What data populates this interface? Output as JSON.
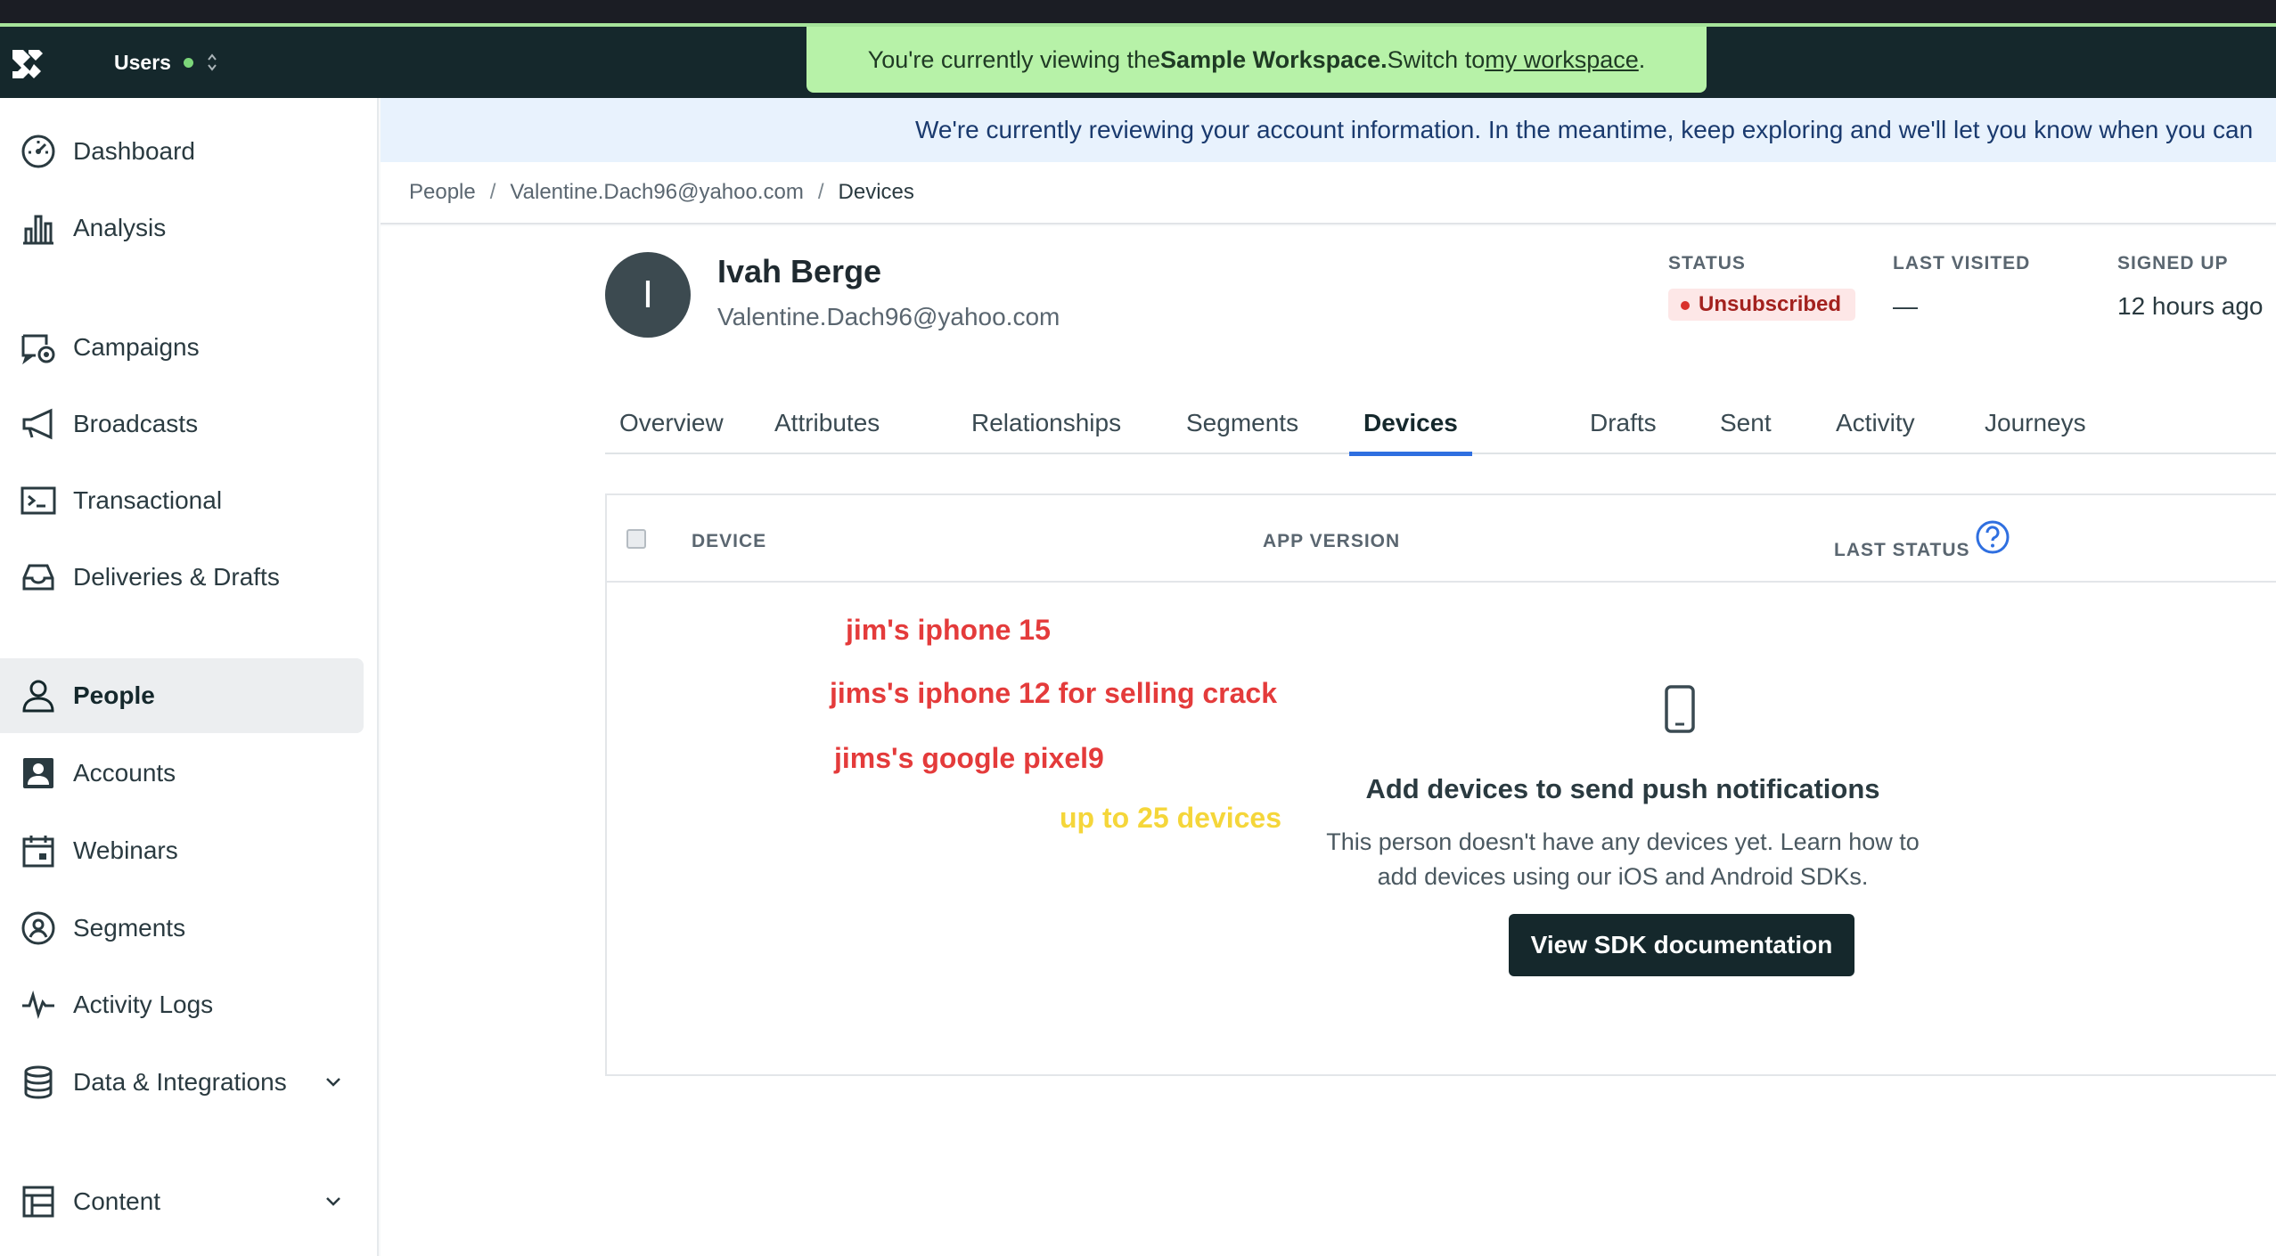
{
  "topbar": {
    "workspace_label": "Users",
    "banner": {
      "prefix": "You're currently viewing the ",
      "workspace_name": "Sample Workspace.",
      "middle": " Switch to ",
      "link": "my workspace",
      "suffix": "."
    }
  },
  "sidebar": {
    "items": [
      {
        "label": "Dashboard",
        "icon": "dashboard-icon"
      },
      {
        "label": "Analysis",
        "icon": "bar-chart-icon"
      },
      {
        "label": "Campaigns",
        "icon": "campaign-icon"
      },
      {
        "label": "Broadcasts",
        "icon": "megaphone-icon"
      },
      {
        "label": "Transactional",
        "icon": "terminal-icon"
      },
      {
        "label": "Deliveries & Drafts",
        "icon": "inbox-icon"
      },
      {
        "label": "People",
        "icon": "person-icon",
        "active": true
      },
      {
        "label": "Accounts",
        "icon": "account-card-icon"
      },
      {
        "label": "Webinars",
        "icon": "calendar-icon"
      },
      {
        "label": "Segments",
        "icon": "segment-icon"
      },
      {
        "label": "Activity Logs",
        "icon": "pulse-icon"
      },
      {
        "label": "Data & Integrations",
        "icon": "database-icon"
      },
      {
        "label": "Content",
        "icon": "layout-icon"
      }
    ]
  },
  "review_banner": "We're currently reviewing your account information. In the meantime, keep exploring and we'll let you know when you can",
  "breadcrumb": {
    "root": "People",
    "person": "Valentine.Dach96@yahoo.com",
    "current": "Devices"
  },
  "profile": {
    "initial": "I",
    "name": "Ivah Berge",
    "email": "Valentine.Dach96@yahoo.com",
    "status_label": "STATUS",
    "status_value": "Unsubscribed",
    "last_visited_label": "LAST VISITED",
    "last_visited_value": "—",
    "signed_up_label": "SIGNED UP",
    "signed_up_value": "12 hours ago"
  },
  "tabs": [
    "Overview",
    "Attributes",
    "Relationships",
    "Segments",
    "Devices",
    "Drafts",
    "Sent",
    "Activity",
    "Journeys"
  ],
  "active_tab": "Devices",
  "devices_table": {
    "columns": [
      "DEVICE",
      "APP VERSION",
      "LAST STATUS"
    ],
    "empty_title": "Add devices to send push notifications",
    "empty_description": "This person doesn't have any devices yet. Learn how to add devices using our iOS and Android SDKs.",
    "button_label": "View SDK documentation"
  },
  "annotations": {
    "line1": "jim's iphone 15",
    "line2": "jims's iphone 12 for selling crack",
    "line3": "jims's google pixel9",
    "line4": "up to 25 devices"
  },
  "colors": {
    "topbar": "#15282c",
    "banner": "#b7f2a8",
    "accent_tab": "#2f6fe0",
    "unsubscribed": "#a3211e",
    "annotation_red": "#e43b3b",
    "annotation_yellow": "#f5d63a"
  }
}
